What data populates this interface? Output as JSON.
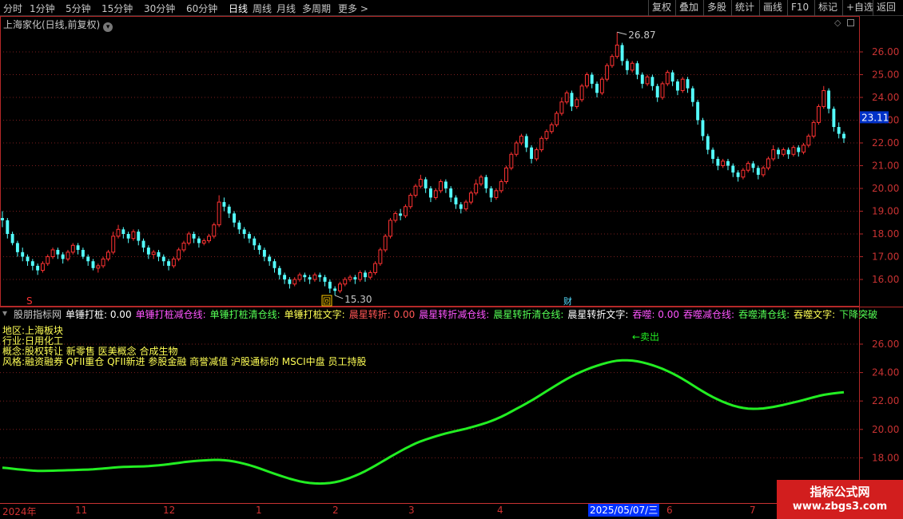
{
  "toolbar": {
    "timeframes": [
      "分时",
      "1分钟",
      "5分钟",
      "15分钟",
      "30分钟",
      "60分钟",
      "日线",
      "周线",
      "月线",
      "多周期",
      "更多"
    ],
    "more_arrow": ">",
    "buttons": [
      "复权",
      "叠加",
      "多股",
      "统计",
      "画线",
      "F10",
      "标记",
      "+自选",
      "返回"
    ]
  },
  "price_panel": {
    "title": "上海家化(日线,前复权)",
    "y_ticks": [
      "26.00",
      "25.00",
      "24.00",
      "23.00",
      "22.00",
      "21.00",
      "20.00",
      "19.00",
      "18.00",
      "17.00",
      "16.00"
    ],
    "current_price": "23.11",
    "high_label": "26.87",
    "low_label": "15.30",
    "markers": {
      "s": "S",
      "hui": "回",
      "cai": "财"
    }
  },
  "indicator": {
    "name": "股朋指标网",
    "labels": [
      {
        "text": "单锤打桩: 0.00",
        "color": "#ffffff"
      },
      {
        "text": "单锤打桩减仓线:",
        "color": "#ff55ff"
      },
      {
        "text": "单锤打桩清仓线:",
        "color": "#55ff55"
      },
      {
        "text": "单锤打桩文字:",
        "color": "#ffff55"
      },
      {
        "text": "晨星转折: 0.00",
        "color": "#ff5555"
      },
      {
        "text": "晨星转折减仓线:",
        "color": "#ff55ff"
      },
      {
        "text": "晨星转折清仓线:",
        "color": "#55ff55"
      },
      {
        "text": "晨星转折文字:",
        "color": "#ffffff"
      },
      {
        "text": "吞噬: 0.00",
        "color": "#ff55ff"
      },
      {
        "text": "吞噬减仓线:",
        "color": "#ff55ff"
      },
      {
        "text": "吞噬清仓线:",
        "color": "#55ff55"
      },
      {
        "text": "吞噬文字:",
        "color": "#ffff55"
      },
      {
        "text": "下降突破",
        "color": "#55ff55"
      }
    ],
    "info_lines": [
      "地区:上海板块",
      "行业:日用化工",
      "概念:股权转让 新零售 医美概念 合成生物",
      "风格:融资融券 QFII重仓 QFII新进 参股金融 商誉减值 沪股通标的 MSCI中盘 员工持股"
    ],
    "sell_label": "←卖出",
    "y_ticks": [
      "26.00",
      "24.00",
      "22.00",
      "20.00",
      "18.00"
    ],
    "line_color": "#22ee22"
  },
  "date_axis": {
    "labels": [
      "2024年",
      "11",
      "12",
      "1",
      "2",
      "3",
      "4",
      "5",
      "6",
      "7"
    ],
    "current": "2025/05/07/三"
  },
  "watermark": {
    "line1": "指标公式网",
    "line2": "www.zbgs3.com"
  },
  "chart_data": {
    "type": "candlestick",
    "title": "上海家化(日线,前复权)",
    "ylim": [
      15.0,
      27.0
    ],
    "annotations": {
      "high": 26.87,
      "low": 15.3,
      "last": 23.11
    },
    "ohlc": [
      [
        18.7,
        18.6,
        19.0,
        18.3
      ],
      [
        18.6,
        18.0,
        18.7,
        17.8
      ],
      [
        18.0,
        17.6,
        18.1,
        17.5
      ],
      [
        17.6,
        17.2,
        17.7,
        17.0
      ],
      [
        17.2,
        17.0,
        17.4,
        16.8
      ],
      [
        17.0,
        16.8,
        17.1,
        16.6
      ],
      [
        16.8,
        16.6,
        16.9,
        16.4
      ],
      [
        16.6,
        16.4,
        16.7,
        16.2
      ],
      [
        16.4,
        16.7,
        16.8,
        16.3
      ],
      [
        16.7,
        17.0,
        17.1,
        16.6
      ],
      [
        17.0,
        17.3,
        17.4,
        16.9
      ],
      [
        17.3,
        17.1,
        17.4,
        16.9
      ],
      [
        17.1,
        16.9,
        17.2,
        16.7
      ],
      [
        16.9,
        17.2,
        17.3,
        16.8
      ],
      [
        17.2,
        17.5,
        17.6,
        17.1
      ],
      [
        17.5,
        17.3,
        17.6,
        17.1
      ],
      [
        17.3,
        17.0,
        17.4,
        16.9
      ],
      [
        17.0,
        16.8,
        17.1,
        16.6
      ],
      [
        16.8,
        16.5,
        16.9,
        16.4
      ],
      [
        16.5,
        16.6,
        16.7,
        16.3
      ],
      [
        16.6,
        16.9,
        17.0,
        16.5
      ],
      [
        16.9,
        17.2,
        17.3,
        16.8
      ],
      [
        17.2,
        17.9,
        18.1,
        17.1
      ],
      [
        17.9,
        18.2,
        18.4,
        17.8
      ],
      [
        18.2,
        18.0,
        18.3,
        17.8
      ],
      [
        18.0,
        17.8,
        18.1,
        17.6
      ],
      [
        17.8,
        18.1,
        18.2,
        17.7
      ],
      [
        18.1,
        17.7,
        18.2,
        17.5
      ],
      [
        17.7,
        17.4,
        17.8,
        17.2
      ],
      [
        17.4,
        17.1,
        17.5,
        16.9
      ],
      [
        17.1,
        17.2,
        17.3,
        16.9
      ],
      [
        17.2,
        17.0,
        17.3,
        16.8
      ],
      [
        17.0,
        16.8,
        17.1,
        16.6
      ],
      [
        16.8,
        16.6,
        16.9,
        16.4
      ],
      [
        16.6,
        16.9,
        17.0,
        16.5
      ],
      [
        16.9,
        17.3,
        17.4,
        16.8
      ],
      [
        17.3,
        17.6,
        17.7,
        17.2
      ],
      [
        17.6,
        18.0,
        18.1,
        17.5
      ],
      [
        18.0,
        17.8,
        18.1,
        17.6
      ],
      [
        17.8,
        17.6,
        17.9,
        17.4
      ],
      [
        17.6,
        17.7,
        17.8,
        17.5
      ],
      [
        17.7,
        17.9,
        18.0,
        17.6
      ],
      [
        17.9,
        18.4,
        18.5,
        17.8
      ],
      [
        18.4,
        19.4,
        19.7,
        18.3
      ],
      [
        19.4,
        19.2,
        19.6,
        19.0
      ],
      [
        19.2,
        18.9,
        19.3,
        18.7
      ],
      [
        18.9,
        18.5,
        19.0,
        18.3
      ],
      [
        18.5,
        18.2,
        18.6,
        18.0
      ],
      [
        18.2,
        18.0,
        18.3,
        17.8
      ],
      [
        18.0,
        17.8,
        18.1,
        17.6
      ],
      [
        17.8,
        17.5,
        17.9,
        17.3
      ],
      [
        17.5,
        17.3,
        17.6,
        17.1
      ],
      [
        17.3,
        17.0,
        17.4,
        16.8
      ],
      [
        17.0,
        16.8,
        17.1,
        16.6
      ],
      [
        16.8,
        16.5,
        16.9,
        16.3
      ],
      [
        16.5,
        16.2,
        16.6,
        16.0
      ],
      [
        16.2,
        16.0,
        16.3,
        15.8
      ],
      [
        16.0,
        15.8,
        16.1,
        15.6
      ],
      [
        15.8,
        16.0,
        16.1,
        15.7
      ],
      [
        16.0,
        16.2,
        16.3,
        15.9
      ],
      [
        16.2,
        16.1,
        16.3,
        15.9
      ],
      [
        16.1,
        16.0,
        16.2,
        15.8
      ],
      [
        16.0,
        16.2,
        16.3,
        15.9
      ],
      [
        16.2,
        16.1,
        16.3,
        15.9
      ],
      [
        16.1,
        15.9,
        16.2,
        15.7
      ],
      [
        15.9,
        15.6,
        16.0,
        15.4
      ],
      [
        15.6,
        15.5,
        15.7,
        15.3
      ],
      [
        15.5,
        15.8,
        15.9,
        15.4
      ],
      [
        15.8,
        16.0,
        16.1,
        15.7
      ],
      [
        16.0,
        16.1,
        16.2,
        15.9
      ],
      [
        16.1,
        16.0,
        16.2,
        15.8
      ],
      [
        16.0,
        16.3,
        16.4,
        15.9
      ],
      [
        16.3,
        16.1,
        16.4,
        15.9
      ],
      [
        16.1,
        16.3,
        16.4,
        16.0
      ],
      [
        16.3,
        16.7,
        16.8,
        16.2
      ],
      [
        16.7,
        17.3,
        17.4,
        16.6
      ],
      [
        17.3,
        17.9,
        18.0,
        17.2
      ],
      [
        17.9,
        18.6,
        18.7,
        17.8
      ],
      [
        18.6,
        18.9,
        19.0,
        18.5
      ],
      [
        18.9,
        18.8,
        19.1,
        18.6
      ],
      [
        18.8,
        19.2,
        19.3,
        18.7
      ],
      [
        19.2,
        19.7,
        19.8,
        19.1
      ],
      [
        19.7,
        20.1,
        20.2,
        19.6
      ],
      [
        20.1,
        20.4,
        20.6,
        20.0
      ],
      [
        20.4,
        20.0,
        20.5,
        19.8
      ],
      [
        20.0,
        19.6,
        20.1,
        19.4
      ],
      [
        19.6,
        19.9,
        20.0,
        19.5
      ],
      [
        19.9,
        20.3,
        20.4,
        19.8
      ],
      [
        20.3,
        20.0,
        20.4,
        19.8
      ],
      [
        20.0,
        19.6,
        20.1,
        19.4
      ],
      [
        19.6,
        19.3,
        19.7,
        19.1
      ],
      [
        19.3,
        19.1,
        19.4,
        18.9
      ],
      [
        19.1,
        19.4,
        19.5,
        19.0
      ],
      [
        19.4,
        19.8,
        19.9,
        19.3
      ],
      [
        19.8,
        20.2,
        20.4,
        19.7
      ],
      [
        20.2,
        20.5,
        20.6,
        20.1
      ],
      [
        20.5,
        20.0,
        20.6,
        19.8
      ],
      [
        20.0,
        19.6,
        20.1,
        19.4
      ],
      [
        19.6,
        19.9,
        20.0,
        19.5
      ],
      [
        19.9,
        20.3,
        20.4,
        19.8
      ],
      [
        20.3,
        20.9,
        21.0,
        20.2
      ],
      [
        20.9,
        21.5,
        21.6,
        20.8
      ],
      [
        21.5,
        22.0,
        22.1,
        21.4
      ],
      [
        22.0,
        22.3,
        22.4,
        21.9
      ],
      [
        22.3,
        21.8,
        22.4,
        21.6
      ],
      [
        21.8,
        21.3,
        21.9,
        21.1
      ],
      [
        21.3,
        21.7,
        21.8,
        21.2
      ],
      [
        21.7,
        22.2,
        22.3,
        21.6
      ],
      [
        22.2,
        22.5,
        22.6,
        22.1
      ],
      [
        22.5,
        22.8,
        22.9,
        22.4
      ],
      [
        22.8,
        23.3,
        23.4,
        22.7
      ],
      [
        23.3,
        23.8,
        24.0,
        23.2
      ],
      [
        23.8,
        24.2,
        24.3,
        23.7
      ],
      [
        24.2,
        23.6,
        24.3,
        23.4
      ],
      [
        23.6,
        23.9,
        24.0,
        23.5
      ],
      [
        23.9,
        24.5,
        24.6,
        23.8
      ],
      [
        24.5,
        25.0,
        25.1,
        24.4
      ],
      [
        25.0,
        24.6,
        25.1,
        24.4
      ],
      [
        24.6,
        24.2,
        24.7,
        24.0
      ],
      [
        24.2,
        24.8,
        24.9,
        24.1
      ],
      [
        24.8,
        25.4,
        25.5,
        24.7
      ],
      [
        25.4,
        25.8,
        25.9,
        25.3
      ],
      [
        25.8,
        26.3,
        26.87,
        25.7
      ],
      [
        26.3,
        25.6,
        26.4,
        25.4
      ],
      [
        25.6,
        25.2,
        25.7,
        25.0
      ],
      [
        25.2,
        25.5,
        25.6,
        25.1
      ],
      [
        25.5,
        25.0,
        25.6,
        24.8
      ],
      [
        25.0,
        24.6,
        25.1,
        24.4
      ],
      [
        24.6,
        24.9,
        25.0,
        24.5
      ],
      [
        24.9,
        24.5,
        25.0,
        24.3
      ],
      [
        24.5,
        24.0,
        24.6,
        23.8
      ],
      [
        24.0,
        24.6,
        24.7,
        23.9
      ],
      [
        24.6,
        25.1,
        25.2,
        24.5
      ],
      [
        25.1,
        24.7,
        25.2,
        24.5
      ],
      [
        24.7,
        24.3,
        24.8,
        24.1
      ],
      [
        24.3,
        24.8,
        24.9,
        24.2
      ],
      [
        24.8,
        24.4,
        24.9,
        24.2
      ],
      [
        24.4,
        23.8,
        24.5,
        23.6
      ],
      [
        23.8,
        23.0,
        23.9,
        22.8
      ],
      [
        23.0,
        22.3,
        23.1,
        22.1
      ],
      [
        22.3,
        21.7,
        22.4,
        21.5
      ],
      [
        21.7,
        21.3,
        21.8,
        21.1
      ],
      [
        21.3,
        21.0,
        21.4,
        20.8
      ],
      [
        21.0,
        21.2,
        21.3,
        20.9
      ],
      [
        21.2,
        21.0,
        21.3,
        20.8
      ],
      [
        21.0,
        20.7,
        21.1,
        20.5
      ],
      [
        20.7,
        20.5,
        20.8,
        20.3
      ],
      [
        20.5,
        20.8,
        20.9,
        20.4
      ],
      [
        20.8,
        21.1,
        21.2,
        20.7
      ],
      [
        21.1,
        20.9,
        21.2,
        20.7
      ],
      [
        20.9,
        20.6,
        21.0,
        20.4
      ],
      [
        20.6,
        20.9,
        21.0,
        20.5
      ],
      [
        20.9,
        21.3,
        21.4,
        20.8
      ],
      [
        21.3,
        21.7,
        21.9,
        21.2
      ],
      [
        21.7,
        21.5,
        21.8,
        21.3
      ],
      [
        21.5,
        21.7,
        21.8,
        21.4
      ],
      [
        21.7,
        21.5,
        21.8,
        21.3
      ],
      [
        21.5,
        21.8,
        21.9,
        21.4
      ],
      [
        21.8,
        21.6,
        21.9,
        21.4
      ],
      [
        21.6,
        21.9,
        22.0,
        21.5
      ],
      [
        21.9,
        22.3,
        22.4,
        21.8
      ],
      [
        22.3,
        22.9,
        23.0,
        22.2
      ],
      [
        22.9,
        23.6,
        23.7,
        22.8
      ],
      [
        23.6,
        24.3,
        24.5,
        23.5
      ],
      [
        24.3,
        23.5,
        24.4,
        23.3
      ],
      [
        23.5,
        22.7,
        23.6,
        22.5
      ],
      [
        22.7,
        22.4,
        22.9,
        22.2
      ],
      [
        22.4,
        22.2,
        22.5,
        22.0
      ]
    ]
  }
}
